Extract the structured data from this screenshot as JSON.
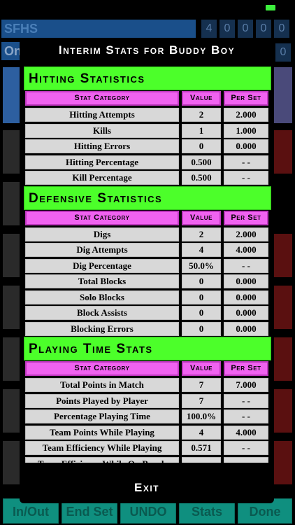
{
  "background": {
    "team_name": "SFHS",
    "scores": [
      "4",
      "0",
      "0",
      "0",
      "0"
    ],
    "on_label": "On",
    "scores2": [
      "0"
    ],
    "bottom_buttons": [
      "In/Out",
      "End Set",
      "UNDO",
      "Stats",
      "Done"
    ]
  },
  "modal": {
    "title": "Interim Stats for Buddy Boy",
    "exit_label": "Exit",
    "sections": [
      {
        "title": "Hitting Statistics",
        "columns": [
          "Stat Category",
          "Value",
          "Per Set"
        ],
        "rows": [
          [
            "Hitting Attempts",
            "2",
            "2.000"
          ],
          [
            "Kills",
            "1",
            "1.000"
          ],
          [
            "Hitting Errors",
            "0",
            "0.000"
          ],
          [
            "Hitting Percentage",
            "0.500",
            "- -"
          ],
          [
            "Kill Percentage",
            "0.500",
            "- -"
          ]
        ]
      },
      {
        "title": "Defensive Statistics",
        "columns": [
          "Stat Category",
          "Value",
          "Per Set"
        ],
        "rows": [
          [
            "Digs",
            "2",
            "2.000"
          ],
          [
            "Dig Attempts",
            "4",
            "4.000"
          ],
          [
            "Dig Percentage",
            "50.0%",
            "- -"
          ],
          [
            "Total Blocks",
            "0",
            "0.000"
          ],
          [
            "Solo Blocks",
            "0",
            "0.000"
          ],
          [
            "Block Assists",
            "0",
            "0.000"
          ],
          [
            "Blocking Errors",
            "0",
            "0.000"
          ]
        ]
      },
      {
        "title": "Playing Time Stats",
        "columns": [
          "Stat Category",
          "Value",
          "Per Set"
        ],
        "rows": [
          [
            "Total Points in Match",
            "7",
            "7.000"
          ],
          [
            "Points Played by Player",
            "7",
            "- -"
          ],
          [
            "Percentage Playing Time",
            "100.0%",
            "- -"
          ],
          [
            "Team Points While Playing",
            "4",
            "4.000"
          ],
          [
            "Team Efficiency While Playing",
            "0.571",
            "- -"
          ],
          [
            "Team Efficiency While On Bench",
            "- -",
            "- -"
          ]
        ]
      }
    ]
  },
  "colors": {
    "section_header": "#4cff2a",
    "column_header": "#f062f0",
    "cell": "#d8d8d8",
    "battery": "#3df03d"
  }
}
